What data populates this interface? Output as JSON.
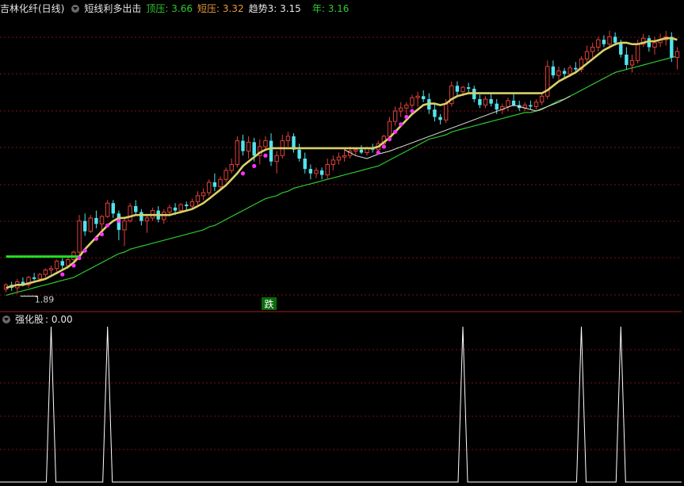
{
  "header": {
    "title": "吉林化纤(日线)",
    "indicator": "短线利多出击",
    "items": [
      {
        "label": "顶压:",
        "value": "3.66",
        "color": "#2ec82e"
      },
      {
        "label": "短压:",
        "value": "3.32",
        "color": "#e59a3b"
      },
      {
        "label": "趋势3:",
        "value": "3.15",
        "color": "#e6e6e6"
      },
      {
        "label": "年:",
        "value": "3.16",
        "color": "#2ec82e"
      }
    ]
  },
  "sub_header": {
    "title": "强化股",
    "value": ": 0.00"
  },
  "annotations": {
    "low_price": "1.89",
    "signal_text": "跌"
  },
  "colors": {
    "up": "#e0403a",
    "down": "#52e4ee",
    "ma_fast": "#d7d067",
    "ma_slow": "#2ec82e",
    "dots": "#ff30ff",
    "short_line": "#e6e6e6",
    "short_green": "#20e020",
    "grid": "#7a1414"
  },
  "chart_data": [
    {
      "type": "candlestick",
      "title": "",
      "y_range": [
        1.85,
        3.75
      ],
      "x_count": 120,
      "candles": [
        [
          0,
          1.92,
          1.96,
          1.9,
          1.95
        ],
        [
          1,
          1.95,
          1.97,
          1.91,
          1.93
        ],
        [
          2,
          1.93,
          1.99,
          1.89,
          1.97
        ],
        [
          3,
          1.97,
          2.0,
          1.94,
          1.95
        ],
        [
          4,
          1.95,
          2.01,
          1.93,
          2.0
        ],
        [
          5,
          2.0,
          2.03,
          1.98,
          1.99
        ],
        [
          6,
          1.99,
          2.03,
          1.97,
          2.02
        ],
        [
          7,
          2.02,
          2.06,
          2.0,
          2.05
        ],
        [
          8,
          2.05,
          2.08,
          2.02,
          2.06
        ],
        [
          9,
          2.06,
          2.12,
          2.04,
          2.11
        ],
        [
          10,
          2.11,
          2.13,
          2.05,
          2.08
        ],
        [
          11,
          2.08,
          2.14,
          2.06,
          2.12
        ],
        [
          12,
          2.12,
          2.18,
          2.1,
          2.17
        ],
        [
          13,
          2.17,
          2.42,
          2.15,
          2.38
        ],
        [
          14,
          2.38,
          2.43,
          2.28,
          2.31
        ],
        [
          15,
          2.31,
          2.42,
          2.3,
          2.4
        ],
        [
          16,
          2.4,
          2.45,
          2.33,
          2.36
        ],
        [
          17,
          2.36,
          2.42,
          2.31,
          2.41
        ],
        [
          18,
          2.41,
          2.52,
          2.4,
          2.5
        ],
        [
          19,
          2.5,
          2.52,
          2.4,
          2.43
        ],
        [
          20,
          2.43,
          2.45,
          2.25,
          2.32
        ],
        [
          21,
          2.32,
          2.41,
          2.21,
          2.38
        ],
        [
          22,
          2.38,
          2.5,
          2.37,
          2.48
        ],
        [
          23,
          2.48,
          2.52,
          2.42,
          2.44
        ],
        [
          24,
          2.44,
          2.46,
          2.35,
          2.38
        ],
        [
          25,
          2.38,
          2.42,
          2.3,
          2.4
        ],
        [
          26,
          2.4,
          2.47,
          2.38,
          2.45
        ],
        [
          27,
          2.45,
          2.48,
          2.37,
          2.39
        ],
        [
          28,
          2.39,
          2.46,
          2.36,
          2.44
        ],
        [
          29,
          2.44,
          2.49,
          2.41,
          2.47
        ],
        [
          30,
          2.47,
          2.5,
          2.42,
          2.45
        ],
        [
          31,
          2.45,
          2.5,
          2.43,
          2.49
        ],
        [
          32,
          2.49,
          2.51,
          2.45,
          2.48
        ],
        [
          33,
          2.48,
          2.53,
          2.46,
          2.51
        ],
        [
          34,
          2.51,
          2.58,
          2.49,
          2.55
        ],
        [
          35,
          2.55,
          2.6,
          2.52,
          2.57
        ],
        [
          36,
          2.57,
          2.66,
          2.55,
          2.64
        ],
        [
          37,
          2.64,
          2.7,
          2.58,
          2.61
        ],
        [
          38,
          2.61,
          2.68,
          2.6,
          2.66
        ],
        [
          39,
          2.66,
          2.74,
          2.64,
          2.72
        ],
        [
          40,
          2.72,
          2.8,
          2.7,
          2.76
        ],
        [
          41,
          2.76,
          2.95,
          2.74,
          2.92
        ],
        [
          42,
          2.92,
          2.96,
          2.82,
          2.85
        ],
        [
          43,
          2.85,
          2.95,
          2.8,
          2.91
        ],
        [
          44,
          2.91,
          2.94,
          2.78,
          2.82
        ],
        [
          45,
          2.82,
          2.93,
          2.76,
          2.88
        ],
        [
          46,
          2.88,
          2.95,
          2.85,
          2.92
        ],
        [
          47,
          2.92,
          2.97,
          2.75,
          2.78
        ],
        [
          48,
          2.78,
          2.85,
          2.7,
          2.82
        ],
        [
          49,
          2.82,
          2.96,
          2.8,
          2.92
        ],
        [
          50,
          2.92,
          2.98,
          2.88,
          2.95
        ],
        [
          51,
          2.95,
          2.97,
          2.84,
          2.86
        ],
        [
          52,
          2.86,
          2.9,
          2.78,
          2.8
        ],
        [
          53,
          2.8,
          2.84,
          2.7,
          2.73
        ],
        [
          54,
          2.73,
          2.76,
          2.66,
          2.7
        ],
        [
          55,
          2.7,
          2.74,
          2.67,
          2.72
        ],
        [
          56,
          2.72,
          2.74,
          2.66,
          2.69
        ],
        [
          57,
          2.69,
          2.8,
          2.66,
          2.76
        ],
        [
          58,
          2.76,
          2.82,
          2.72,
          2.79
        ],
        [
          59,
          2.79,
          2.84,
          2.76,
          2.81
        ],
        [
          60,
          2.81,
          2.86,
          2.78,
          2.82
        ],
        [
          61,
          2.82,
          2.88,
          2.8,
          2.85
        ],
        [
          62,
          2.85,
          2.87,
          2.82,
          2.86
        ],
        [
          63,
          2.86,
          2.89,
          2.83,
          2.84
        ],
        [
          64,
          2.84,
          2.88,
          2.82,
          2.87
        ],
        [
          65,
          2.87,
          2.9,
          2.84,
          2.86
        ],
        [
          66,
          2.86,
          2.92,
          2.84,
          2.9
        ],
        [
          67,
          2.9,
          2.96,
          2.88,
          2.95
        ],
        [
          68,
          2.95,
          3.08,
          2.93,
          3.05
        ],
        [
          69,
          3.05,
          3.15,
          3.02,
          3.12
        ],
        [
          70,
          3.12,
          3.18,
          3.08,
          3.14
        ],
        [
          71,
          3.14,
          3.18,
          3.1,
          3.16
        ],
        [
          72,
          3.16,
          3.23,
          3.14,
          3.21
        ],
        [
          73,
          3.21,
          3.25,
          3.15,
          3.22
        ],
        [
          74,
          3.22,
          3.26,
          3.18,
          3.2
        ],
        [
          75,
          3.2,
          3.24,
          3.1,
          3.13
        ],
        [
          76,
          3.13,
          3.17,
          3.05,
          3.08
        ],
        [
          77,
          3.08,
          3.1,
          3.03,
          3.06
        ],
        [
          78,
          3.06,
          3.2,
          3.04,
          3.17
        ],
        [
          79,
          3.17,
          3.32,
          3.15,
          3.29
        ],
        [
          80,
          3.29,
          3.32,
          3.22,
          3.25
        ],
        [
          81,
          3.25,
          3.29,
          3.22,
          3.28
        ],
        [
          82,
          3.28,
          3.31,
          3.24,
          3.27
        ],
        [
          83,
          3.27,
          3.29,
          3.18,
          3.2
        ],
        [
          84,
          3.2,
          3.23,
          3.14,
          3.16
        ],
        [
          85,
          3.16,
          3.22,
          3.14,
          3.2
        ],
        [
          86,
          3.2,
          3.24,
          3.15,
          3.17
        ],
        [
          87,
          3.17,
          3.2,
          3.1,
          3.13
        ],
        [
          88,
          3.13,
          3.17,
          3.1,
          3.15
        ],
        [
          89,
          3.15,
          3.21,
          3.12,
          3.19
        ],
        [
          90,
          3.19,
          3.24,
          3.15,
          3.16
        ],
        [
          91,
          3.16,
          3.19,
          3.12,
          3.14
        ],
        [
          92,
          3.14,
          3.18,
          3.12,
          3.16
        ],
        [
          93,
          3.16,
          3.19,
          3.13,
          3.15
        ],
        [
          94,
          3.15,
          3.2,
          3.13,
          3.18
        ],
        [
          95,
          3.18,
          3.24,
          3.16,
          3.22
        ],
        [
          96,
          3.22,
          3.46,
          3.2,
          3.42
        ],
        [
          97,
          3.42,
          3.46,
          3.34,
          3.36
        ],
        [
          98,
          3.36,
          3.42,
          3.33,
          3.39
        ],
        [
          99,
          3.39,
          3.41,
          3.34,
          3.37
        ],
        [
          100,
          3.37,
          3.43,
          3.35,
          3.41
        ],
        [
          101,
          3.41,
          3.45,
          3.38,
          3.4
        ],
        [
          102,
          3.4,
          3.49,
          3.38,
          3.47
        ],
        [
          103,
          3.47,
          3.56,
          3.45,
          3.52
        ],
        [
          104,
          3.52,
          3.58,
          3.48,
          3.55
        ],
        [
          105,
          3.55,
          3.62,
          3.52,
          3.6
        ],
        [
          106,
          3.6,
          3.63,
          3.55,
          3.57
        ],
        [
          107,
          3.57,
          3.66,
          3.54,
          3.62
        ],
        [
          108,
          3.62,
          3.65,
          3.56,
          3.58
        ],
        [
          109,
          3.58,
          3.6,
          3.48,
          3.5
        ],
        [
          110,
          3.5,
          3.55,
          3.4,
          3.43
        ],
        [
          111,
          3.43,
          3.5,
          3.38,
          3.46
        ],
        [
          112,
          3.46,
          3.6,
          3.44,
          3.57
        ],
        [
          113,
          3.57,
          3.64,
          3.55,
          3.61
        ],
        [
          114,
          3.61,
          3.63,
          3.52,
          3.55
        ],
        [
          115,
          3.55,
          3.62,
          3.5,
          3.58
        ],
        [
          116,
          3.58,
          3.64,
          3.55,
          3.6
        ],
        [
          117,
          3.6,
          3.66,
          3.56,
          3.62
        ],
        [
          118,
          3.62,
          3.65,
          3.45,
          3.48
        ],
        [
          119,
          3.48,
          3.55,
          3.4,
          3.52
        ]
      ],
      "ma_fast": [
        1.93,
        1.94,
        1.95,
        1.95,
        1.96,
        1.97,
        1.98,
        1.99,
        2.01,
        2.03,
        2.05,
        2.07,
        2.1,
        2.14,
        2.19,
        2.23,
        2.27,
        2.31,
        2.35,
        2.38,
        2.4,
        2.4,
        2.41,
        2.42,
        2.42,
        2.42,
        2.42,
        2.42,
        2.42,
        2.42,
        2.43,
        2.44,
        2.45,
        2.46,
        2.48,
        2.5,
        2.53,
        2.56,
        2.59,
        2.62,
        2.66,
        2.7,
        2.75,
        2.78,
        2.81,
        2.84,
        2.86,
        2.87,
        2.87,
        2.87,
        2.87,
        2.87,
        2.87,
        2.87,
        2.87,
        2.87,
        2.87,
        2.87,
        2.87,
        2.87,
        2.87,
        2.87,
        2.87,
        2.87,
        2.87,
        2.87,
        2.88,
        2.91,
        2.94,
        2.98,
        3.02,
        3.06,
        3.1,
        3.13,
        3.16,
        3.17,
        3.17,
        3.16,
        3.17,
        3.2,
        3.22,
        3.23,
        3.24,
        3.24,
        3.24,
        3.24,
        3.24,
        3.24,
        3.24,
        3.24,
        3.24,
        3.24,
        3.24,
        3.24,
        3.24,
        3.24,
        3.26,
        3.29,
        3.32,
        3.34,
        3.36,
        3.38,
        3.41,
        3.44,
        3.47,
        3.5,
        3.53,
        3.55,
        3.57,
        3.58,
        3.58,
        3.57,
        3.57,
        3.58,
        3.59,
        3.59,
        3.6,
        3.61,
        3.61,
        3.6
      ],
      "ma_slow": [
        1.88,
        1.89,
        1.9,
        1.91,
        1.92,
        1.93,
        1.94,
        1.95,
        1.96,
        1.97,
        1.98,
        1.99,
        2.0,
        2.02,
        2.04,
        2.06,
        2.08,
        2.1,
        2.12,
        2.14,
        2.16,
        2.17,
        2.19,
        2.2,
        2.21,
        2.22,
        2.23,
        2.24,
        2.25,
        2.26,
        2.27,
        2.28,
        2.29,
        2.3,
        2.31,
        2.32,
        2.34,
        2.35,
        2.37,
        2.39,
        2.41,
        2.43,
        2.45,
        2.47,
        2.49,
        2.51,
        2.53,
        2.54,
        2.55,
        2.57,
        2.58,
        2.6,
        2.61,
        2.62,
        2.63,
        2.64,
        2.65,
        2.66,
        2.67,
        2.68,
        2.69,
        2.7,
        2.71,
        2.72,
        2.73,
        2.74,
        2.75,
        2.77,
        2.79,
        2.81,
        2.83,
        2.85,
        2.87,
        2.89,
        2.91,
        2.93,
        2.94,
        2.95,
        2.96,
        2.98,
        2.99,
        3.0,
        3.01,
        3.02,
        3.03,
        3.04,
        3.05,
        3.06,
        3.07,
        3.08,
        3.09,
        3.1,
        3.11,
        3.11,
        3.12,
        3.13,
        3.15,
        3.17,
        3.19,
        3.2,
        3.22,
        3.24,
        3.26,
        3.28,
        3.3,
        3.32,
        3.34,
        3.36,
        3.38,
        3.39,
        3.4,
        3.41,
        3.42,
        3.43,
        3.44,
        3.45,
        3.46,
        3.47,
        3.48,
        3.49
      ],
      "short_line": [
        [
          60,
          2.86
        ],
        [
          62,
          2.82
        ],
        [
          64,
          2.8
        ],
        [
          66,
          2.83
        ],
        [
          68,
          2.85
        ],
        [
          90,
          3.16
        ],
        [
          94,
          3.12
        ],
        [
          98,
          3.18
        ],
        [
          100,
          3.22
        ]
      ],
      "dots": [
        [
          10,
          2.02
        ],
        [
          12,
          2.08
        ],
        [
          13,
          2.13
        ],
        [
          14,
          2.18
        ],
        [
          16,
          2.26
        ],
        [
          17,
          2.29
        ],
        [
          18,
          2.35
        ],
        [
          20,
          2.38
        ],
        [
          42,
          2.7
        ],
        [
          44,
          2.75
        ],
        [
          46,
          2.82
        ],
        [
          66,
          2.84
        ],
        [
          67,
          2.88
        ],
        [
          68,
          2.93
        ],
        [
          69,
          2.98
        ],
        [
          70,
          3.03
        ],
        [
          71,
          3.08
        ],
        [
          72,
          3.12
        ]
      ],
      "green_segment": [
        [
          0,
          2.14
        ],
        [
          13,
          2.14
        ]
      ],
      "low_marker": {
        "index": 2,
        "value": 1.89
      }
    },
    {
      "type": "line",
      "title": "强化股",
      "y_range": [
        0,
        1
      ],
      "x_count": 120,
      "spikes": [
        8,
        18,
        81,
        102,
        109
      ],
      "value": 0.0
    }
  ]
}
